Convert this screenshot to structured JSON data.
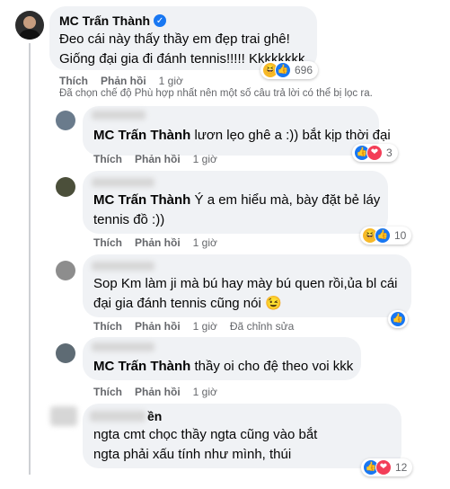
{
  "main_comment": {
    "author": "MC Trấn Thành",
    "verified_icon": "verified-badge-icon",
    "line1": "Đeo cái này thấy thầy em đẹp trai ghê!",
    "line2": "Giống đại gia đi đánh tennis!!!!! Kkkkkkkk",
    "like_label": "Thích",
    "reply_label": "Phản hồi",
    "time": "1 giờ",
    "reaction_count": "696",
    "reactions": [
      "haha-icon",
      "like-icon"
    ]
  },
  "filter_notice": "Đã chọn chế độ Phù hợp nhất nên một số câu trả lời có thể bị lọc ra.",
  "replies": [
    {
      "author": "MC Trấn Thành",
      "text": "lươn lẹo ghê a :)) bắt kịp thời đại",
      "like_label": "Thích",
      "reply_label": "Phản hồi",
      "time": "1 giờ",
      "reaction_count": "3"
    },
    {
      "author": "MC Trấn Thành",
      "text_line1": "Ý a em hiểu mà, bày đặt bẻ láy",
      "text_line2": "tennis đồ :))",
      "like_label": "Thích",
      "reply_label": "Phản hồi",
      "time": "1 giờ",
      "reaction_count": "10"
    },
    {
      "text_line1": "Sop Km làm ji mà bú hay mày bú quen rồi,ủa bl cái",
      "text_line2": "đại gia đánh tennis cũng nói",
      "emoji": "😉",
      "like_label": "Thích",
      "reply_label": "Phản hồi",
      "time": "1 giờ",
      "edit_label": "Đã chỉnh sửa"
    },
    {
      "author": "MC Trấn Thành",
      "text": "thầy oi cho đệ theo voi kkk",
      "like_label": "Thích",
      "reply_label": "Phản hồi",
      "time": "1 giờ"
    },
    {
      "author_partial": "ền",
      "text_line1": "ngta cmt chọc thầy ngta cũng vào bắt",
      "text_line2": "ngta phải xấu tính như mình, thúi",
      "reaction_count": "12"
    }
  ]
}
